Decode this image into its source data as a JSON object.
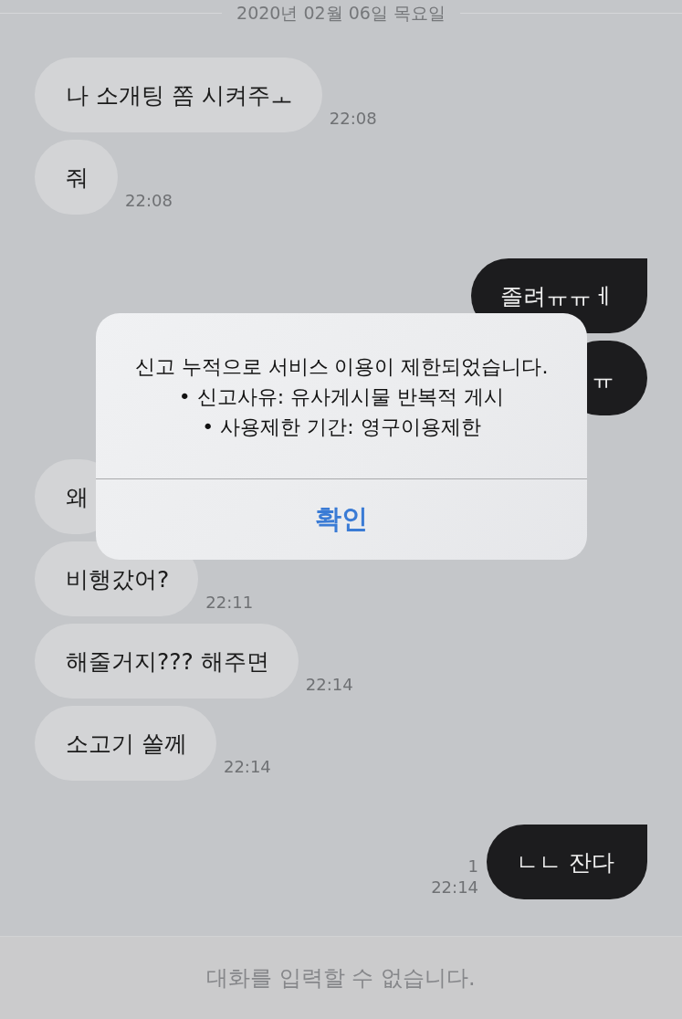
{
  "date_header": "2020년 02월 06일 목요일",
  "messages": [
    {
      "kind": "received",
      "text": "나 소개팅 쫌 시켜주ㅗ",
      "time": "22:08",
      "tail": false
    },
    {
      "kind": "received",
      "text": "줘",
      "time": "22:08",
      "tail": false
    },
    {
      "kind": "sent",
      "text": "졸려ㅠㅠㅔ",
      "tail": true
    },
    {
      "kind": "sent",
      "text": "ㅠ",
      "tail": false
    },
    {
      "kind": "received",
      "text": "왜",
      "tail": false
    },
    {
      "kind": "received",
      "text": "비행갔어?",
      "time": "22:11",
      "tail": false
    },
    {
      "kind": "received",
      "text": "해줄거지??? 해주면",
      "time": "22:14",
      "tail": false
    },
    {
      "kind": "received",
      "text": "소고기 쏠께",
      "time": "22:14",
      "tail": false
    },
    {
      "kind": "sent",
      "text": "ㄴㄴ 잔다",
      "unread": "1",
      "time": "22:14",
      "tail": true
    }
  ],
  "alert": {
    "message": "신고 누적으로 서비스 이용이 제한되었습니다.\n• 신고사유: 유사게시물 반복적 게시\n• 사용제한 기간: 영구이용제한",
    "button": "확인"
  },
  "composer": {
    "placeholder": "대화를 입력할 수 없습니다.",
    "disabled": true
  }
}
